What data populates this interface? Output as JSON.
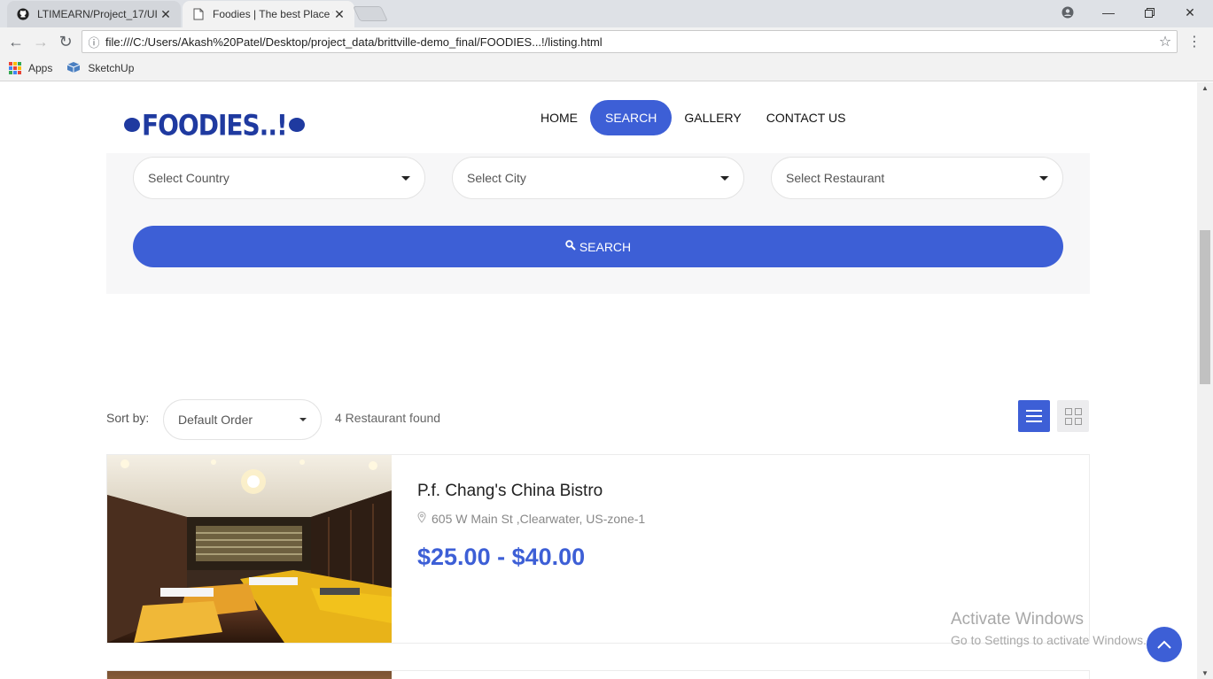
{
  "browser": {
    "tabs": [
      {
        "title": "LTIMEARN/Project_17/UI",
        "icon": "github-icon",
        "active": false
      },
      {
        "title": "Foodies | The best Place f",
        "icon": "page-icon",
        "active": true
      }
    ],
    "url": "file:///C:/Users/Akash%20Patel/Desktop/project_data/brittville-demo_final/FOODIES...!/listing.html",
    "bookmarks": [
      {
        "label": "Apps",
        "icon": "apps-grid-icon"
      },
      {
        "label": "SketchUp",
        "icon": "sketchup-icon"
      }
    ]
  },
  "site": {
    "logo": "FOODIES..!",
    "nav": [
      {
        "label": "HOME",
        "active": false
      },
      {
        "label": "SEARCH",
        "active": true
      },
      {
        "label": "GALLERY",
        "active": false
      },
      {
        "label": "CONTACT US",
        "active": false
      }
    ],
    "accent": "#3d5fd6"
  },
  "search": {
    "country_placeholder": "Select Country",
    "city_placeholder": "Select City",
    "restaurant_placeholder": "Select Restaurant",
    "button_label": "SEARCH"
  },
  "listing": {
    "sort_label": "Sort by:",
    "sort_value": "Default Order",
    "found_text": "4 Restaurant found",
    "items": [
      {
        "name": "P.f. Chang's China Bistro",
        "address": "605 W Main St ,Clearwater, US-zone-1",
        "price": "$25.00 - $40.00"
      }
    ]
  },
  "overlay": {
    "activate_title": "Activate Windows",
    "activate_sub": "Go to Settings to activate Windows."
  }
}
